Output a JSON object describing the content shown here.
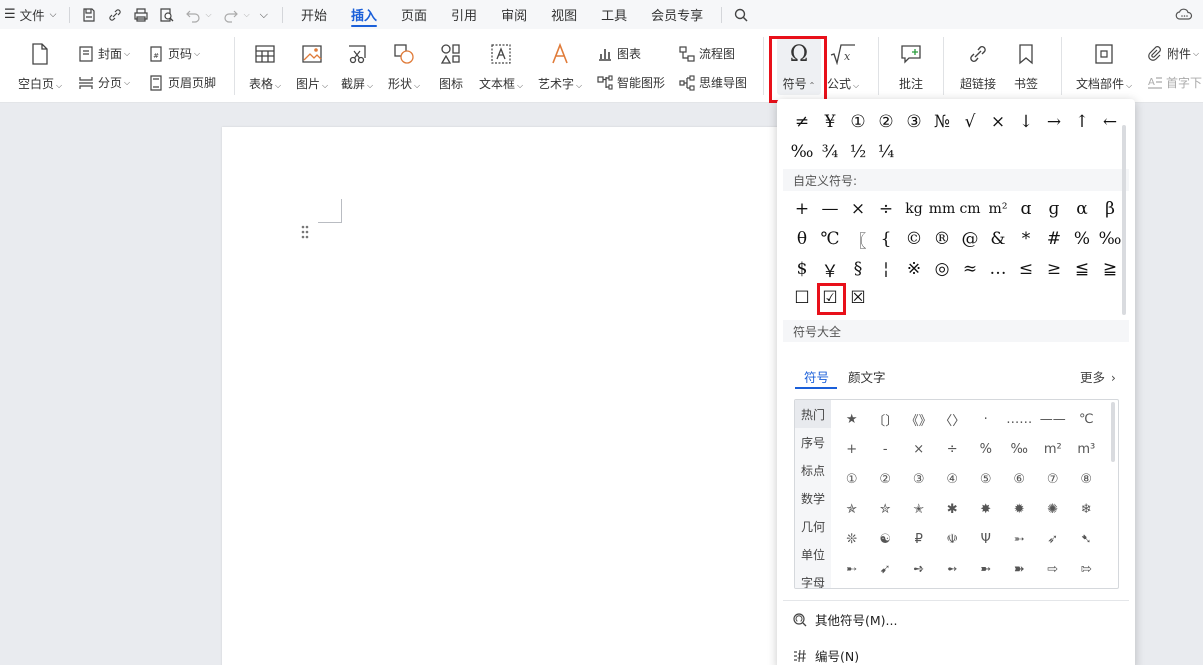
{
  "menubar": {
    "file_label": "文件",
    "tabs": [
      "开始",
      "插入",
      "页面",
      "引用",
      "审阅",
      "视图",
      "工具",
      "会员专享"
    ],
    "active_tab": "插入"
  },
  "ribbon": {
    "blank_page": "空白页",
    "cover": "封面",
    "page_break": "分页",
    "page_number": "页码",
    "header_footer": "页眉页脚",
    "table": "表格",
    "picture": "图片",
    "screenshot": "截屏",
    "shape": "形状",
    "icon": "图标",
    "textbox": "文本框",
    "wordart": "艺术字",
    "chart": "图表",
    "smartart": "智能图形",
    "flowchart": "流程图",
    "mindmap": "思维导图",
    "symbol": "符号",
    "formula": "公式",
    "comment": "批注",
    "hyperlink": "超链接",
    "bookmark": "书签",
    "doc_parts": "文档部件",
    "attachment": "附件",
    "dropcap": "首字下"
  },
  "panel": {
    "recent_row1": [
      "≠",
      "¥",
      "①",
      "②",
      "③",
      "№",
      "√",
      "×",
      "↓",
      "→",
      "↑",
      "←"
    ],
    "recent_row2": [
      "‰",
      "¾",
      "½",
      "¼"
    ],
    "custom_label": "自定义符号:",
    "custom_row1": [
      "+",
      "—",
      "×",
      "÷",
      "kg",
      "mm",
      "cm",
      "m²",
      "ɑ",
      "ɡ",
      "α",
      "β"
    ],
    "custom_row2": [
      "θ",
      "℃",
      "〖",
      "{",
      "©",
      "®",
      "@",
      "&",
      "*",
      "#",
      "%",
      "‰"
    ],
    "custom_row3": [
      "$",
      "￥",
      "§",
      "¦",
      "※",
      "◎",
      "≈",
      "…",
      "≤",
      "≥",
      "≦",
      "≧"
    ],
    "custom_row4": [
      "☐",
      "☑",
      "☒"
    ],
    "all_symbols_label": "符号大全",
    "sub_tabs": [
      "符号",
      "颜文字"
    ],
    "more_label": "更多",
    "categories": [
      "热门",
      "序号",
      "标点",
      "数学",
      "几何",
      "单位",
      "字母"
    ],
    "grid_rows": [
      [
        "★",
        "〔〕",
        "《》",
        "〈〉",
        "·",
        "……",
        "——",
        "℃"
      ],
      [
        "+",
        "-",
        "×",
        "÷",
        "%",
        "‰",
        "m²",
        "m³"
      ],
      [
        "①",
        "②",
        "③",
        "④",
        "⑤",
        "⑥",
        "⑦",
        "⑧"
      ],
      [
        "✯",
        "✮",
        "✭",
        "✱",
        "✸",
        "✹",
        "✺",
        "❄"
      ],
      [
        "❊",
        "☯",
        "₽",
        "☫",
        "Ψ",
        "➵",
        "➶",
        "➷"
      ],
      [
        "➸",
        "➹",
        "➺",
        "➻",
        "➼",
        "➽",
        "⇨",
        "⇰"
      ]
    ],
    "other_symbols": "其他符号(M)...",
    "numbering": "编号(N)"
  }
}
